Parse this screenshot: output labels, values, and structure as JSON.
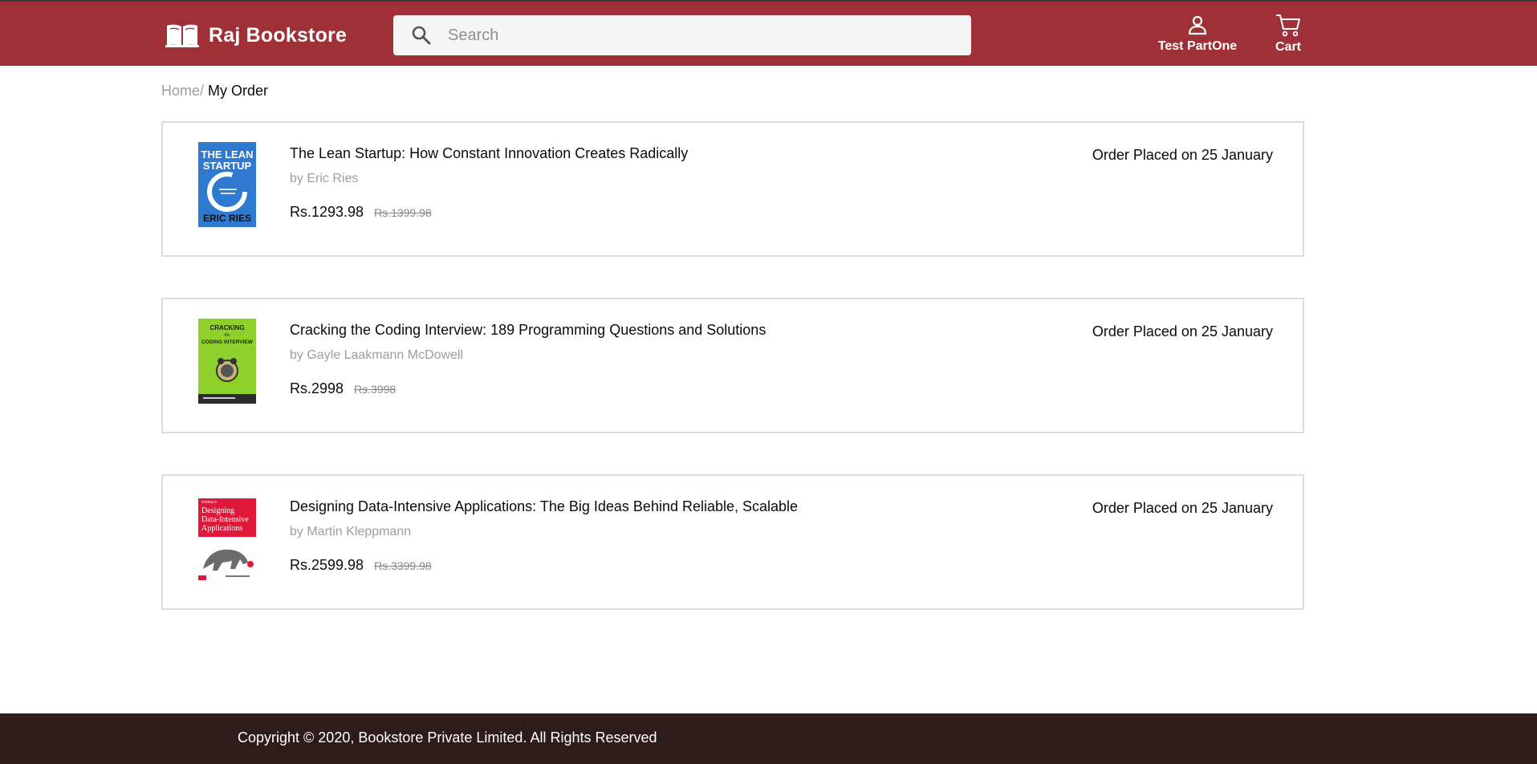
{
  "header": {
    "brand": "Raj Bookstore",
    "search_placeholder": "Search",
    "user_label": "Test PartOne",
    "cart_label": "Cart",
    "brand_color": "#a03037"
  },
  "breadcrumb": {
    "home": "Home/",
    "current": "My Order"
  },
  "orders": [
    {
      "title": "The Lean Startup: How Constant Innovation Creates Radically",
      "author": "by Eric Ries",
      "price": "Rs.1293.98",
      "mrp": "Rs.1399.98",
      "status": "Order Placed on 25 January",
      "cover": {
        "line1": "THE LEAN",
        "line2": "STARTUP",
        "line3": "ERIC RIES"
      }
    },
    {
      "title": "Cracking the Coding Interview: 189 Programming Questions and Solutions",
      "author": "by Gayle Laakmann McDowell",
      "price": "Rs.2998",
      "mrp": "Rs.3998",
      "status": "Order Placed on 25 January",
      "cover": {
        "line1": "CRACKING",
        "line2": "the",
        "line3": "CODING INTERVIEW"
      }
    },
    {
      "title": "Designing Data-Intensive Applications: The Big Ideas Behind Reliable, Scalable",
      "author": "by Martin Kleppmann",
      "price": "Rs.2599.98",
      "mrp": "Rs.3399.98",
      "status": "Order Placed on 25 January",
      "cover": {
        "line1": "O'REILLY",
        "line2": "Designing",
        "line3": "Data-Intensive",
        "line4": "Applications"
      }
    }
  ],
  "footer": {
    "copyright": "Copyright © 2020, Bookstore Private Limited. All Rights Reserved"
  }
}
